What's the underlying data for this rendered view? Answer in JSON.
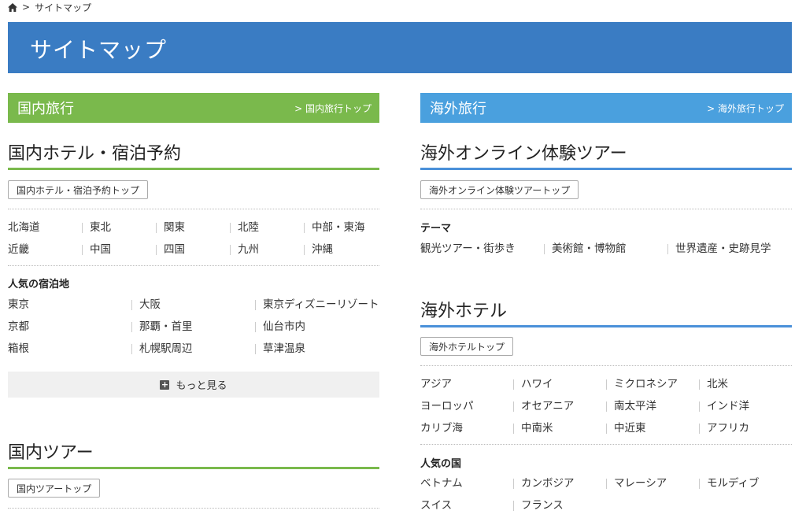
{
  "breadcrumb": {
    "separator": ">",
    "current": "サイトマップ"
  },
  "page_title": "サイトマップ",
  "left": {
    "bar": {
      "title": "国内旅行",
      "link": "> 国内旅行トップ"
    },
    "hotel": {
      "title": "国内ホテル・宿泊予約",
      "top_button": "国内ホテル・宿泊予約トップ",
      "regions": [
        "北海道",
        "東北",
        "関東",
        "北陸",
        "中部・東海",
        "近畿",
        "中国",
        "四国",
        "九州",
        "沖縄"
      ],
      "popular_heading": "人気の宿泊地",
      "popular": [
        "東京",
        "大阪",
        "東京ディズニーリゾート",
        "京都",
        "那覇・首里",
        "仙台市内",
        "箱根",
        "札幌駅周辺",
        "草津温泉"
      ],
      "more_label": "もっと見る"
    },
    "tour": {
      "title": "国内ツアー",
      "top_button": "国内ツアートップ"
    }
  },
  "right": {
    "bar": {
      "title": "海外旅行",
      "link": "> 海外旅行トップ"
    },
    "online": {
      "title": "海外オンライン体験ツアー",
      "top_button": "海外オンライン体験ツアートップ",
      "theme_heading": "テーマ",
      "themes": [
        "観光ツアー・街歩き",
        "美術館・博物館",
        "世界遺産・史跡見学"
      ]
    },
    "hotel": {
      "title": "海外ホテル",
      "top_button": "海外ホテルトップ",
      "regions": [
        "アジア",
        "ハワイ",
        "ミクロネシア",
        "北米",
        "ヨーロッパ",
        "オセアニア",
        "南太平洋",
        "インド洋",
        "カリブ海",
        "中南米",
        "中近東",
        "アフリカ"
      ],
      "popular_heading": "人気の国",
      "popular": [
        "ベトナム",
        "カンボジア",
        "マレーシア",
        "モルディブ",
        "スイス",
        "フランス"
      ]
    }
  },
  "colors": {
    "hero": "#3a7cc3",
    "domestic": "#7ab94c",
    "overseas": "#4aa0de"
  }
}
